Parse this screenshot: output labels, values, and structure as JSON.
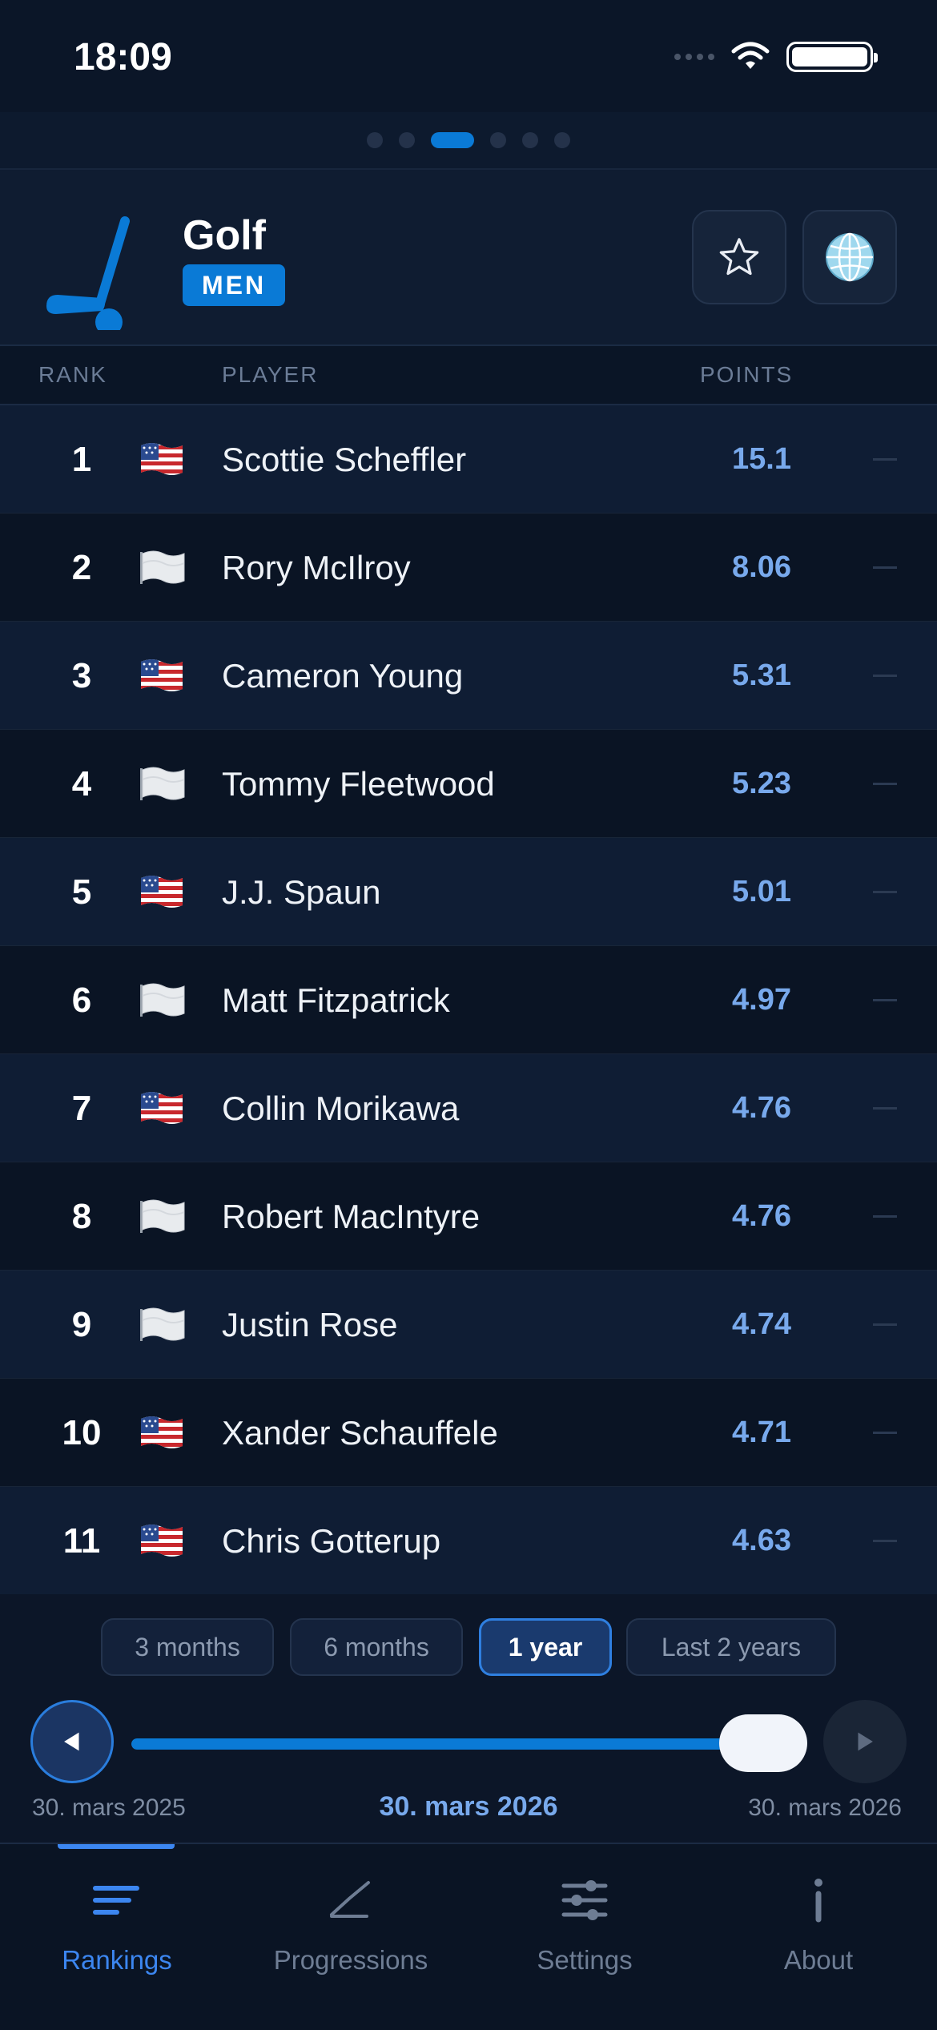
{
  "status_bar": {
    "time": "18:09"
  },
  "pager": {
    "page_count": 6,
    "active_index": 2
  },
  "header": {
    "sport_icon": "golf-club-icon",
    "title": "Golf",
    "badge": "MEN",
    "favorite_icon": "star-icon",
    "region_icon": "globe-icon"
  },
  "columns": {
    "rank": "RANK",
    "player": "PLAYER",
    "points": "POINTS"
  },
  "rows": [
    {
      "rank": "1",
      "flag": "us-flag-icon",
      "player": "Scottie Scheffler",
      "points": "15.1",
      "trend": "—"
    },
    {
      "rank": "2",
      "flag": "white-flag-icon",
      "player": "Rory McIlroy",
      "points": "8.06",
      "trend": "—"
    },
    {
      "rank": "3",
      "flag": "us-flag-icon",
      "player": "Cameron Young",
      "points": "5.31",
      "trend": "—"
    },
    {
      "rank": "4",
      "flag": "white-flag-icon",
      "player": "Tommy Fleetwood",
      "points": "5.23",
      "trend": "—"
    },
    {
      "rank": "5",
      "flag": "us-flag-icon",
      "player": "J.J. Spaun",
      "points": "5.01",
      "trend": "—"
    },
    {
      "rank": "6",
      "flag": "white-flag-icon",
      "player": "Matt Fitzpatrick",
      "points": "4.97",
      "trend": "—"
    },
    {
      "rank": "7",
      "flag": "us-flag-icon",
      "player": "Collin Morikawa",
      "points": "4.76",
      "trend": "—"
    },
    {
      "rank": "8",
      "flag": "white-flag-icon",
      "player": "Robert MacIntyre",
      "points": "4.76",
      "trend": "—"
    },
    {
      "rank": "9",
      "flag": "white-flag-icon",
      "player": "Justin Rose",
      "points": "4.74",
      "trend": "—"
    },
    {
      "rank": "10",
      "flag": "us-flag-icon",
      "player": "Xander Schauffele",
      "points": "4.71",
      "trend": "—"
    },
    {
      "rank": "11",
      "flag": "us-flag-icon",
      "player": "Chris Gotterup",
      "points": "4.63",
      "trend": "—"
    }
  ],
  "range": {
    "options": [
      {
        "label": "3 months",
        "active": false
      },
      {
        "label": "6 months",
        "active": false
      },
      {
        "label": "1 year",
        "active": true
      },
      {
        "label": "Last 2 years",
        "active": false
      }
    ],
    "start_date": "30. mars 2025",
    "selected_date": "30. mars 2026",
    "end_date": "30. mars 2026",
    "slider_fraction": 1.0
  },
  "tabs": [
    {
      "label": "Rankings",
      "icon": "rankings-icon",
      "active": true
    },
    {
      "label": "Progressions",
      "icon": "progressions-icon",
      "active": false
    },
    {
      "label": "Settings",
      "icon": "settings-sliders-icon",
      "active": false
    },
    {
      "label": "About",
      "icon": "info-icon",
      "active": false
    }
  ],
  "colors": {
    "accent": "#0a7ad6",
    "points": "#78a9ec",
    "tab_active": "#3c86f0",
    "background": "#0a1424"
  }
}
